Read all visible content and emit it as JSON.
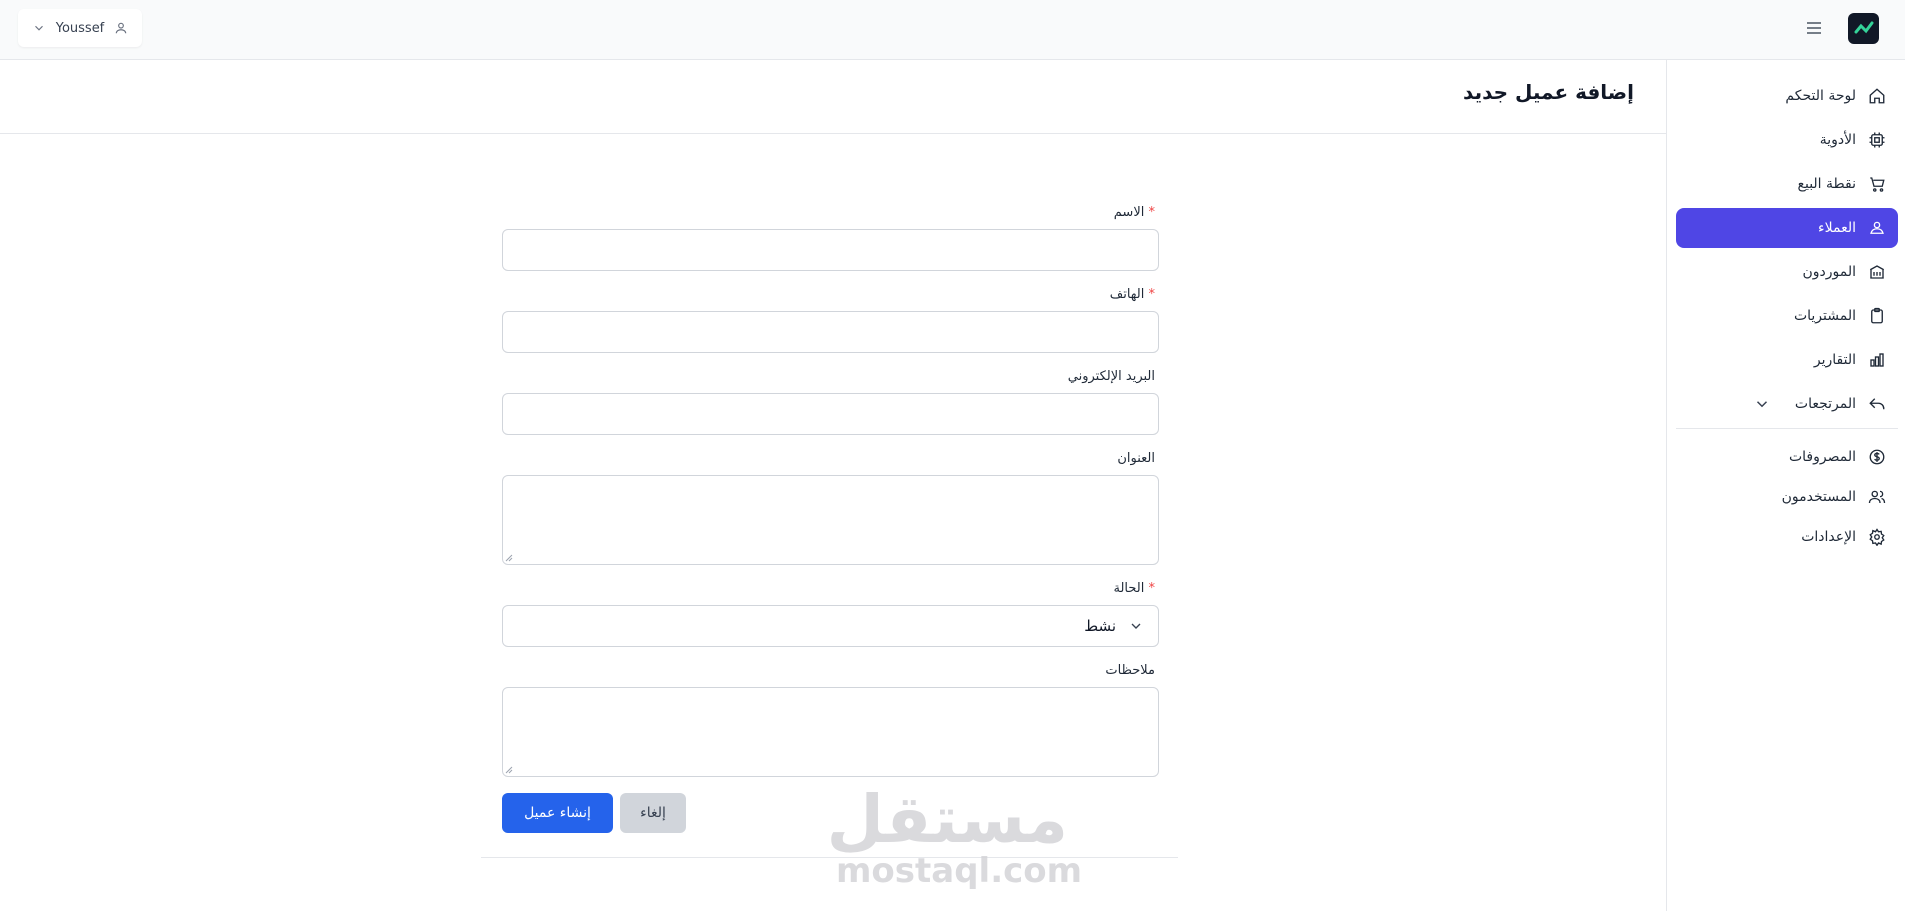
{
  "topbar": {
    "user_name": "Youssef",
    "user_icon": "user-icon",
    "chevron_icon": "chevron-down-icon",
    "menu_icon": "hamburger-icon",
    "logo_icon": "app-logo"
  },
  "sidebar": {
    "items": [
      {
        "label": "لوحة التحكم",
        "icon": "home-icon"
      },
      {
        "label": "الأدوية",
        "icon": "chip-icon"
      },
      {
        "label": "نقطة البيع",
        "icon": "cart-icon"
      },
      {
        "label": "العملاء",
        "icon": "customers-icon",
        "active": true
      },
      {
        "label": "الموردون",
        "icon": "building-icon"
      },
      {
        "label": "المشتريات",
        "icon": "clipboard-icon"
      },
      {
        "label": "التقارير",
        "icon": "chart-icon"
      },
      {
        "label": "المرتجعات",
        "icon": "return-icon"
      },
      {
        "label": "المصروفات",
        "icon": "dollar-icon"
      },
      {
        "label": "المستخدمون",
        "icon": "users-icon"
      },
      {
        "label": "الإعدادات",
        "icon": "settings-icon"
      }
    ]
  },
  "page": {
    "title": "إضافة عميل جديد"
  },
  "form": {
    "name_label": "الاسم",
    "phone_label": "الهاتف",
    "email_label": "البريد الإلكتروني",
    "address_label": "العنوان",
    "status_label": "الحالة",
    "status_value": "نشط",
    "notes_label": "ملاحظات",
    "required_mark": "*",
    "submit_label": "إنشاء عميل",
    "cancel_label": "إلغاء"
  },
  "watermark": {
    "arabic": "مستقل",
    "latin": "mostaql.com"
  },
  "colors": {
    "accent": "#4f46e5",
    "primary_button": "#2563eb",
    "required": "#ef4444"
  }
}
